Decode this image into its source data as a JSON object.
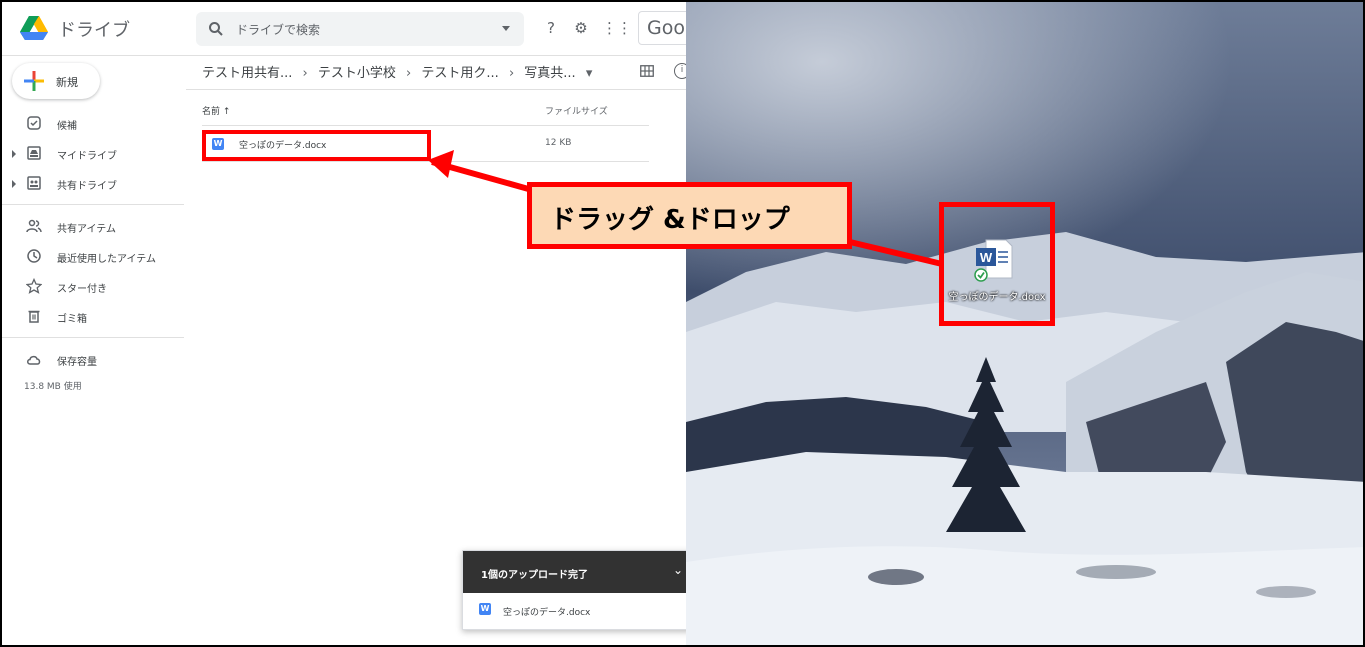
{
  "app": {
    "title": "ドライブ"
  },
  "search": {
    "placeholder": "ドライブで検索"
  },
  "toolbar": {
    "google_label": "Goog"
  },
  "sidebar": {
    "new_button": "新規",
    "items": [
      {
        "label": "候補",
        "icon": "check-circle-icon"
      },
      {
        "label": "マイドライブ",
        "icon": "my-drive-icon"
      },
      {
        "label": "共有ドライブ",
        "icon": "shared-drive-icon"
      },
      {
        "label": "共有アイテム",
        "icon": "people-icon"
      },
      {
        "label": "最近使用したアイテム",
        "icon": "clock-icon"
      },
      {
        "label": "スター付き",
        "icon": "star-icon"
      },
      {
        "label": "ゴミ箱",
        "icon": "trash-icon"
      },
      {
        "label": "保存容量",
        "icon": "cloud-icon"
      }
    ],
    "storage_text": "13.8 MB 使用"
  },
  "breadcrumb": [
    "テスト用共有...",
    "テスト小学校",
    "テスト用ク...",
    "写真共..."
  ],
  "breadcrumb_sep": "›",
  "list": {
    "col_name": "名前 ↑",
    "col_size": "ファイルサイズ",
    "rows": [
      {
        "name": "空っぽのデータ.docx",
        "size": "12 KB",
        "type_badge": "W"
      }
    ]
  },
  "toast": {
    "title": "1個のアップロード完了",
    "file": "空っぽのデータ.docx"
  },
  "desktop": {
    "icon_label": "空っぽのデータ.docx"
  },
  "callout": {
    "text": "ドラッグ &ドロップ"
  },
  "colors": {
    "highlight": "#ff0000",
    "callout_bg": "#fdd9b5",
    "word_blue": "#2b579a"
  }
}
